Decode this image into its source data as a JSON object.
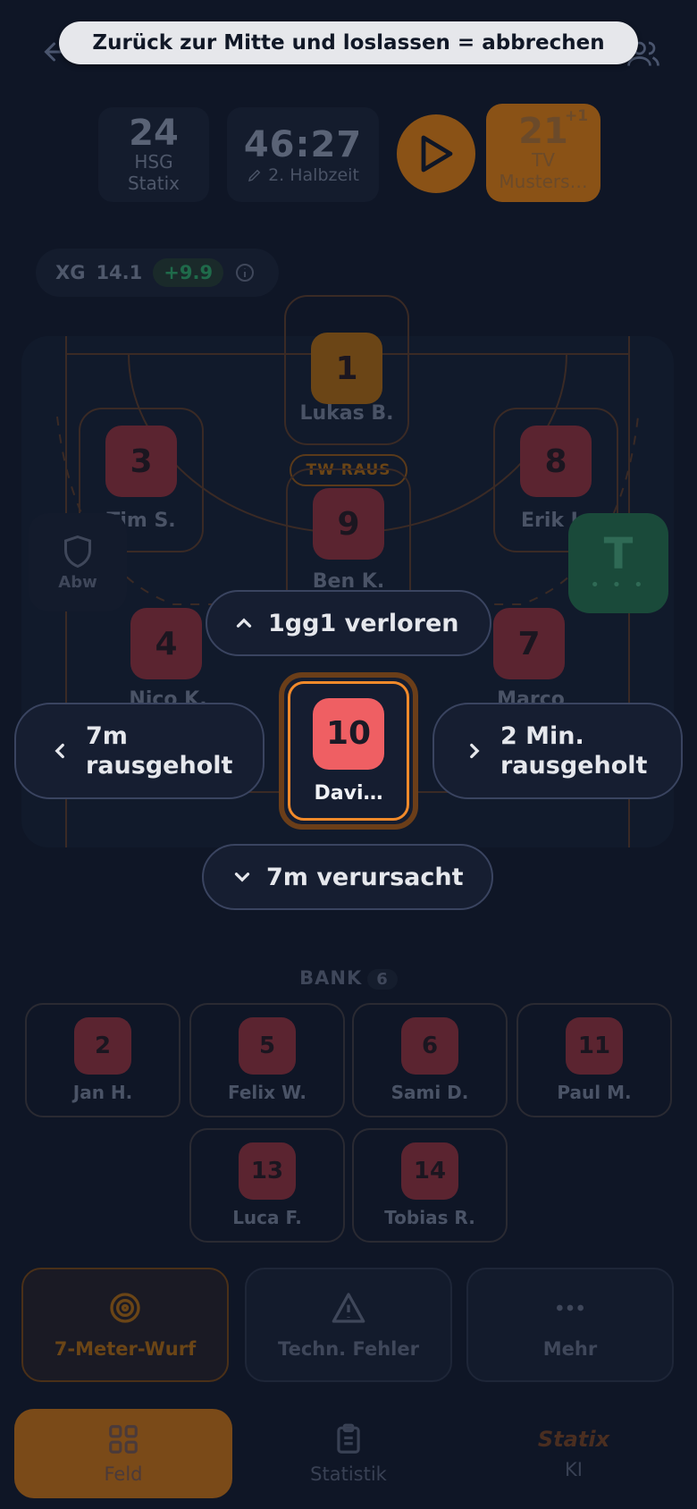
{
  "toast": "Zurück zur Mitte und loslassen = abbrechen",
  "header": {
    "home": {
      "score": "24",
      "name_line1": "HSG",
      "name_line2": "Statix"
    },
    "clock": "46:27",
    "half": "2. Halbzeit",
    "away": {
      "score": "21",
      "plus": "+1",
      "name_line1": "TV",
      "name_line2": "Musters…"
    }
  },
  "xg": {
    "label": "XG",
    "value": "14.1",
    "delta": "+9.9"
  },
  "field": {
    "goalkeeper": {
      "number": "1",
      "name": "Lukas B."
    },
    "tw_raus": "TW RAUS",
    "players": [
      {
        "number": "3",
        "name": "Tim S."
      },
      {
        "number": "9",
        "name": "Ben K."
      },
      {
        "number": "8",
        "name": "Erik L."
      },
      {
        "number": "4",
        "name": "Nico K."
      },
      {
        "number": "7",
        "name": "Marco"
      }
    ],
    "abw_label": "Abw",
    "timeout_label": "T",
    "timeout_dots": "• • •"
  },
  "gesture": {
    "up": "1gg1 verloren",
    "left": "7m rausgeholt",
    "left_line1": "7m",
    "left_line2": "rausgeholt",
    "right_line1": "2 Min.",
    "right_line2": "rausgeholt",
    "down": "7m verursacht"
  },
  "selected": {
    "number": "10",
    "name": "Davi…"
  },
  "bank": {
    "label": "BANK",
    "count": "6",
    "players": [
      {
        "number": "2",
        "name": "Jan H."
      },
      {
        "number": "5",
        "name": "Felix W."
      },
      {
        "number": "6",
        "name": "Sami D."
      },
      {
        "number": "11",
        "name": "Paul M."
      },
      {
        "number": "13",
        "name": "Luca F."
      },
      {
        "number": "14",
        "name": "Tobias R."
      }
    ]
  },
  "actions": {
    "seven_meter": "7-Meter-Wurf",
    "tech_error": "Techn. Fehler",
    "more": "Mehr"
  },
  "nav": {
    "field": "Feld",
    "stats": "Statistik",
    "ai_logo": "Statix",
    "ai": "KI"
  },
  "colors": {
    "accent": "#f28a2a",
    "jersey": "#ef5f63",
    "timeout": "#1a4a3a"
  }
}
